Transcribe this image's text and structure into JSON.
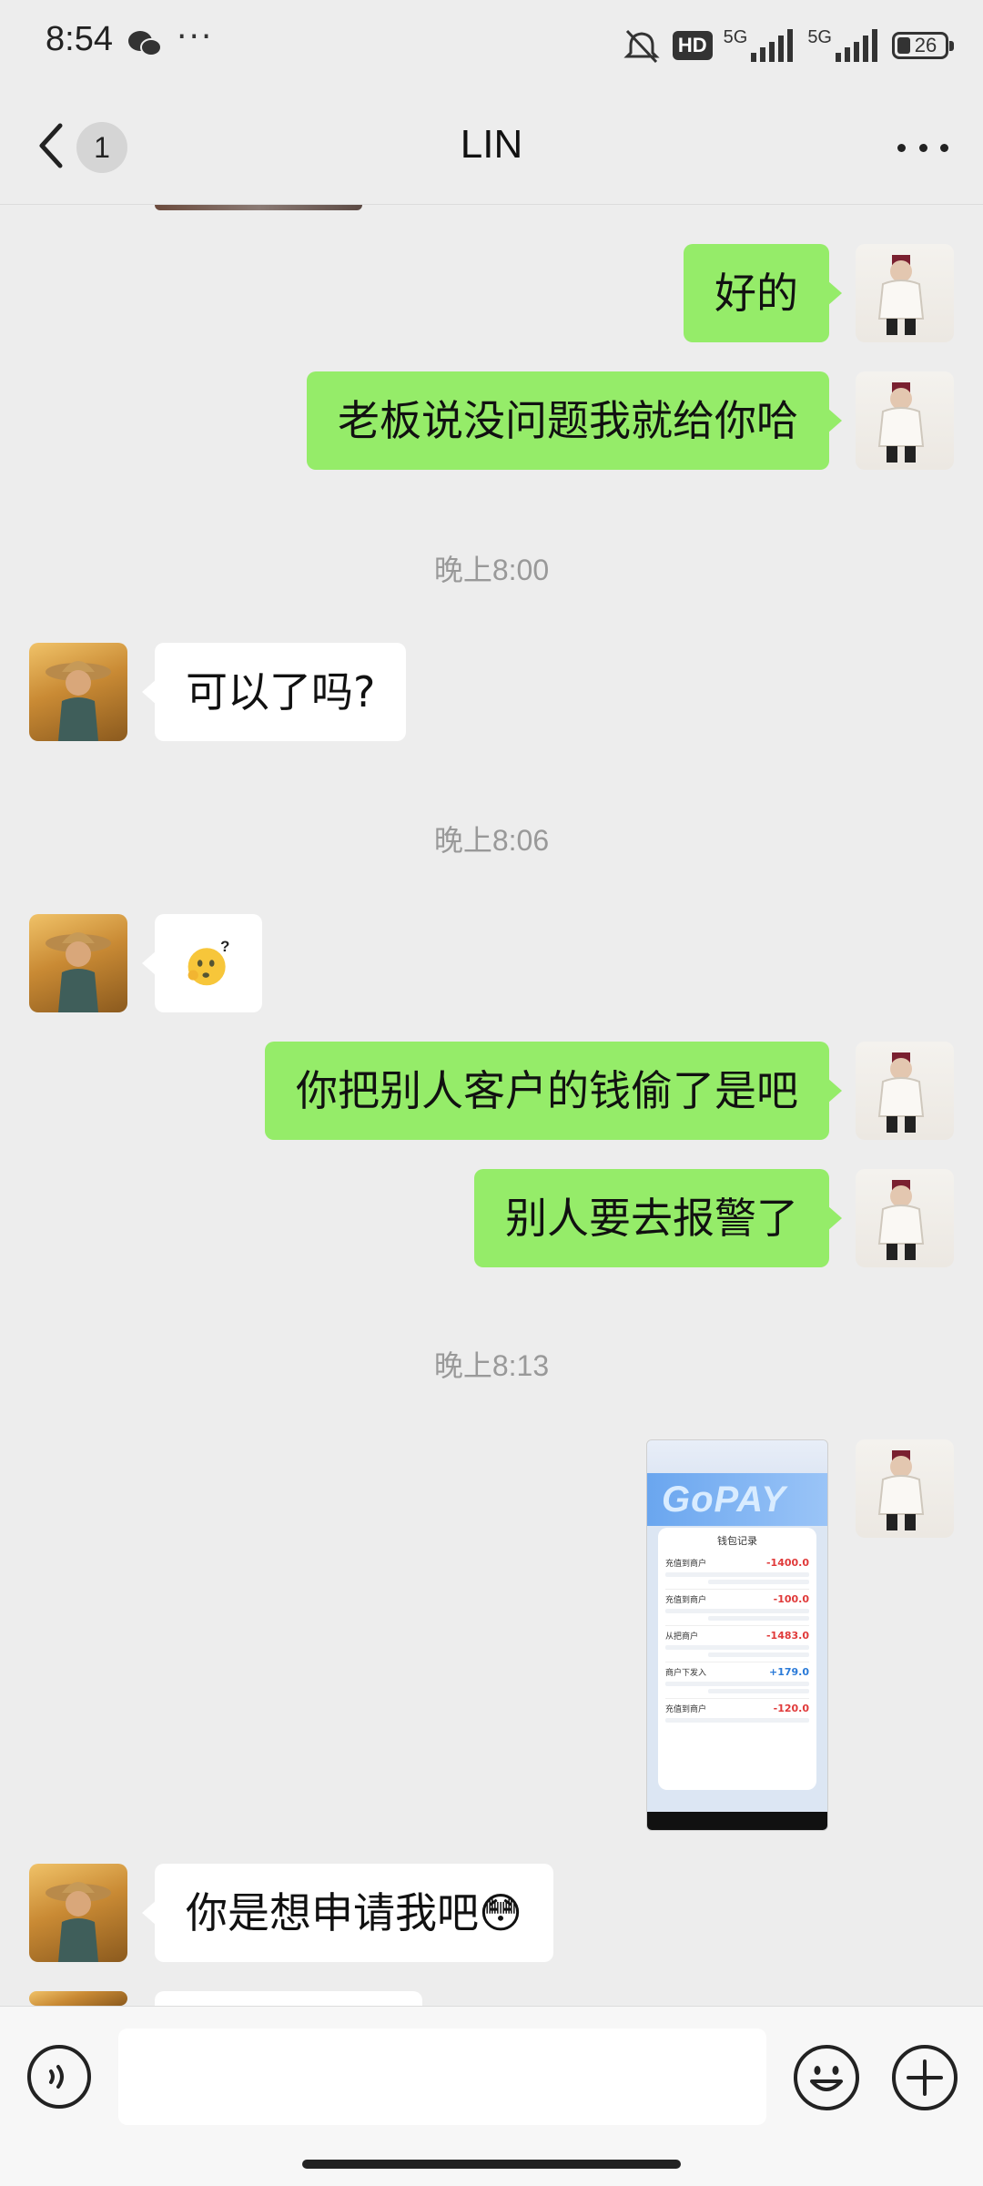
{
  "status_bar": {
    "time": "8:54",
    "dots": "···",
    "hd_label": "HD",
    "network_1": "5G",
    "network_2": "5G",
    "battery": "26"
  },
  "header": {
    "unread_count": "1",
    "title": "LIN"
  },
  "messages": [
    {
      "side": "self",
      "text": "好的"
    },
    {
      "side": "self",
      "text": "老板说没问题我就给你哈"
    },
    {
      "type": "time",
      "text": "晚上8:00"
    },
    {
      "side": "other",
      "text": "可以了吗?"
    },
    {
      "type": "time",
      "text": "晚上8:06"
    },
    {
      "side": "other",
      "text": "🫨"
    },
    {
      "side": "self",
      "text": "你把别人客户的钱偷了是吧"
    },
    {
      "side": "self",
      "text": "别人要去报警了"
    },
    {
      "type": "time",
      "text": "晚上8:13"
    },
    {
      "side": "self",
      "type": "image",
      "text": ""
    },
    {
      "side": "other",
      "text": "你是想申请我吧😳"
    }
  ],
  "screenshot_image": {
    "brand": "GoPAY",
    "sheet_title": "钱包记录",
    "rows": [
      {
        "label": "充值到商户",
        "amount": "-1400.0"
      },
      {
        "label": "充值到商户",
        "amount": "-100.0"
      },
      {
        "label": "从把商户",
        "amount": "-1483.0"
      },
      {
        "label": "商户下发入",
        "amount": "+179.0"
      },
      {
        "label": "充值到商户",
        "amount": "-120.0"
      }
    ]
  },
  "input": {
    "placeholder": ""
  },
  "colors": {
    "self_bubble": "#95ec69",
    "other_bubble": "#ffffff",
    "background": "#ededed"
  }
}
